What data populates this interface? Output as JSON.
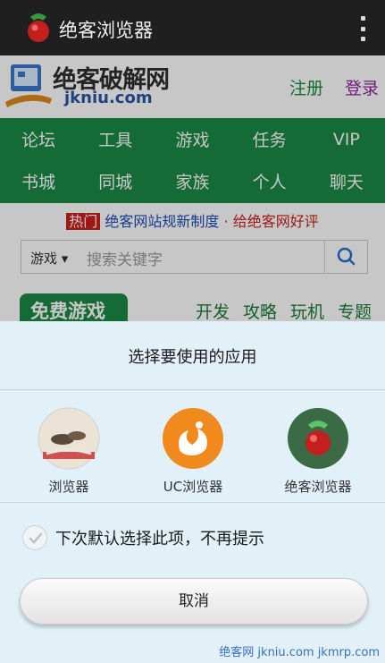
{
  "appbar": {
    "title": "绝客浏览器"
  },
  "site": {
    "logo_text": "绝客破解网",
    "logo_domain": "jkniu.com",
    "register": "注册",
    "login": "登录",
    "nav_row1": [
      "论坛",
      "工具",
      "游戏",
      "任务",
      "VIP"
    ],
    "nav_row2": [
      "书城",
      "同城",
      "家族",
      "个人",
      "聊天"
    ],
    "hot_tag": "热门",
    "hot_text_a": "绝客网站规新制度",
    "hot_text_b": "· 给绝客网好评",
    "search_category": "游戏",
    "search_placeholder": "搜索关键字",
    "free_games": "免费游戏",
    "category_links": [
      "开发",
      "攻略",
      "玩机",
      "专题"
    ]
  },
  "chooser": {
    "title": "选择要使用的应用",
    "apps": [
      {
        "label": "浏览器",
        "icon": "browser-app-icon"
      },
      {
        "label": "UC浏览器",
        "icon": "uc-browser-app-icon"
      },
      {
        "label": "绝客浏览器",
        "icon": "jueke-browser-app-icon"
      }
    ],
    "remember_label": "下次默认选择此项，不再提示",
    "remember_checked": true,
    "cancel_label": "取消"
  },
  "watermark": "绝客网 jkniu.com jkmrp.com",
  "colors": {
    "nav_green": "#1a8a45",
    "sheet_bg": "#e2f0f8",
    "uc_orange": "#f08a1d",
    "appbar": "#1f1f1f"
  }
}
